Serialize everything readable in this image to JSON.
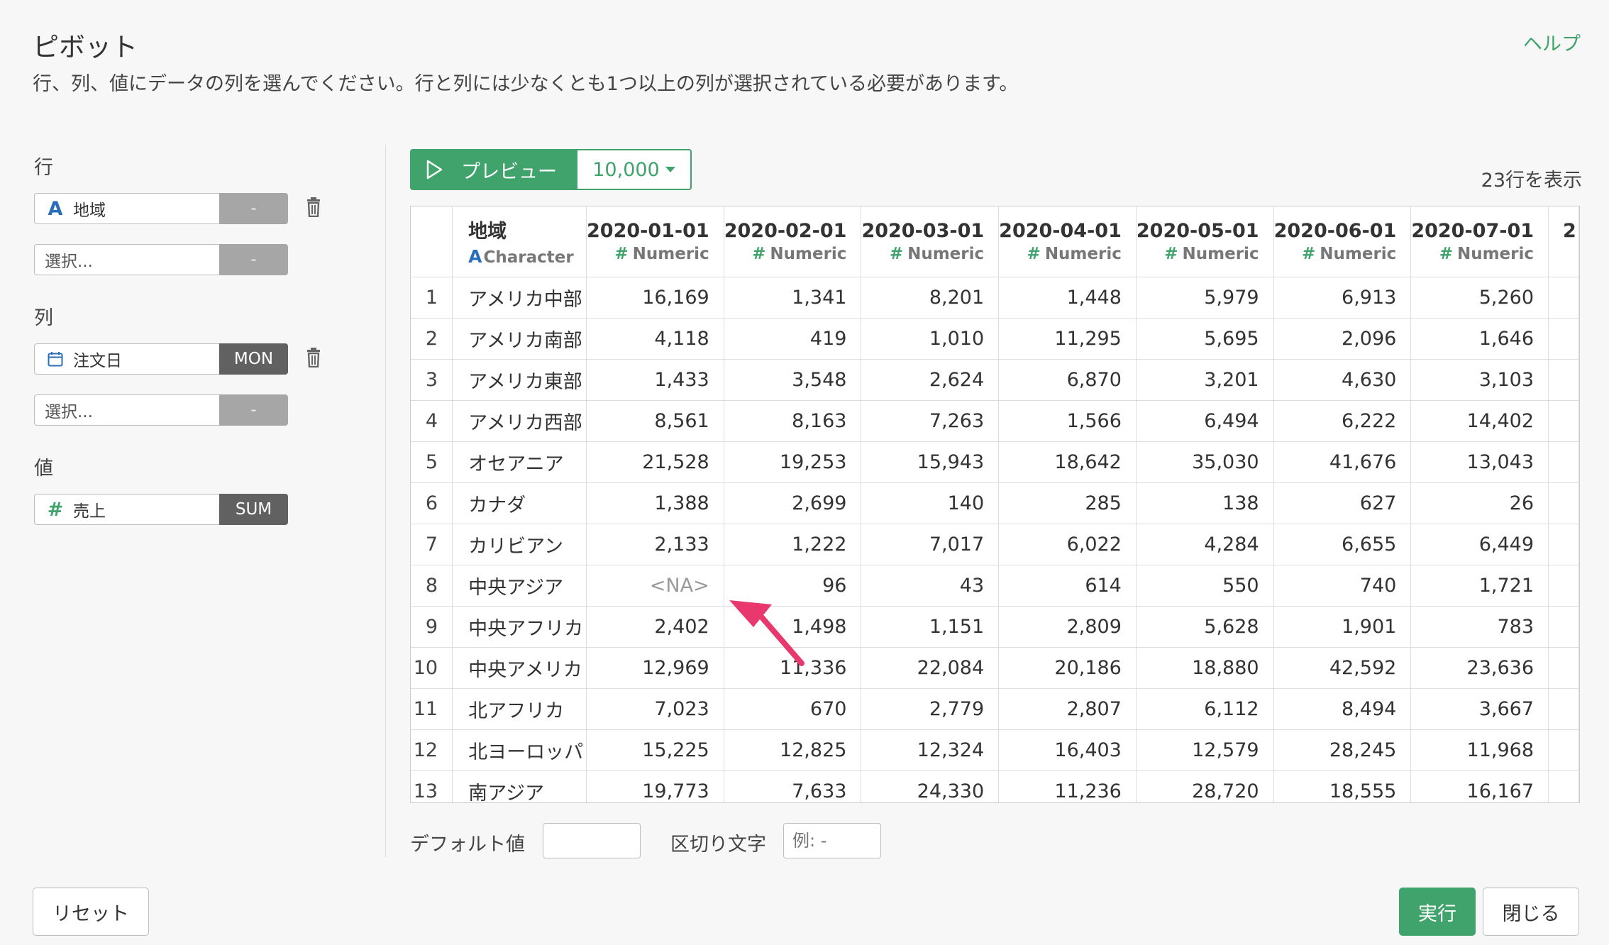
{
  "header": {
    "title": "ピボット",
    "description": "行、列、値にデータの列を選んでください。行と列には少なくとも1つ以上の列が選択されている必要があります。",
    "help_label": "ヘルプ"
  },
  "rows_section": {
    "label": "行",
    "field": {
      "type_icon": "A",
      "name": "地域",
      "option": "-"
    },
    "empty_select": {
      "placeholder": "選択...",
      "option": "-"
    }
  },
  "columns_section": {
    "label": "列",
    "field": {
      "type_icon": "calendar-icon",
      "name": "注文日",
      "option": "MON"
    },
    "empty_select": {
      "placeholder": "選択...",
      "option": "-"
    }
  },
  "values_section": {
    "label": "値",
    "field": {
      "type_icon": "#",
      "name": "売上",
      "option": "SUM"
    }
  },
  "preview": {
    "button_label": "プレビュー",
    "row_limit": "10,000",
    "row_count_text": "23行を表示"
  },
  "table": {
    "columns": [
      {
        "name": "地域",
        "type_icon": "A",
        "type": "Character"
      },
      {
        "name": "2020-01-01",
        "type_icon": "#",
        "type": "Numeric"
      },
      {
        "name": "2020-02-01",
        "type_icon": "#",
        "type": "Numeric"
      },
      {
        "name": "2020-03-01",
        "type_icon": "#",
        "type": "Numeric"
      },
      {
        "name": "2020-04-01",
        "type_icon": "#",
        "type": "Numeric"
      },
      {
        "name": "2020-05-01",
        "type_icon": "#",
        "type": "Numeric"
      },
      {
        "name": "2020-06-01",
        "type_icon": "#",
        "type": "Numeric"
      },
      {
        "name": "2020-07-01",
        "type_icon": "#",
        "type": "Numeric"
      },
      {
        "name": "2",
        "type_icon": "",
        "type": ""
      }
    ],
    "rows": [
      [
        "1",
        "アメリカ中部",
        "16,169",
        "1,341",
        "8,201",
        "1,448",
        "5,979",
        "6,913",
        "5,260"
      ],
      [
        "2",
        "アメリカ南部",
        "4,118",
        "419",
        "1,010",
        "11,295",
        "5,695",
        "2,096",
        "1,646"
      ],
      [
        "3",
        "アメリカ東部",
        "1,433",
        "3,548",
        "2,624",
        "6,870",
        "3,201",
        "4,630",
        "3,103"
      ],
      [
        "4",
        "アメリカ西部",
        "8,561",
        "8,163",
        "7,263",
        "1,566",
        "6,494",
        "6,222",
        "14,402"
      ],
      [
        "5",
        "オセアニア",
        "21,528",
        "19,253",
        "15,943",
        "18,642",
        "35,030",
        "41,676",
        "13,043"
      ],
      [
        "6",
        "カナダ",
        "1,388",
        "2,699",
        "140",
        "285",
        "138",
        "627",
        "26"
      ],
      [
        "7",
        "カリビアン",
        "2,133",
        "1,222",
        "7,017",
        "6,022",
        "4,284",
        "6,655",
        "6,449"
      ],
      [
        "8",
        "中央アジア",
        "<NA>",
        "96",
        "43",
        "614",
        "550",
        "740",
        "1,721"
      ],
      [
        "9",
        "中央アフリカ",
        "2,402",
        "1,498",
        "1,151",
        "2,809",
        "5,628",
        "1,901",
        "783"
      ],
      [
        "10",
        "中央アメリカ",
        "12,969",
        "11,336",
        "22,084",
        "20,186",
        "18,880",
        "42,592",
        "23,636"
      ],
      [
        "11",
        "北アフリカ",
        "7,023",
        "670",
        "2,779",
        "2,807",
        "6,112",
        "8,494",
        "3,667"
      ],
      [
        "12",
        "北ヨーロッパ",
        "15,225",
        "12,825",
        "12,324",
        "16,403",
        "12,579",
        "28,245",
        "11,968"
      ],
      [
        "13",
        "南アジア",
        "19,773",
        "7,633",
        "24,330",
        "11,236",
        "28,720",
        "18,555",
        "16,167"
      ]
    ]
  },
  "options": {
    "default_value_label": "デフォルト値",
    "default_value": "",
    "separator_label": "区切り文字",
    "separator_placeholder": "例: -"
  },
  "footer": {
    "reset_label": "リセット",
    "run_label": "実行",
    "close_label": "閉じる"
  },
  "colors": {
    "accent_green": "#3fa36b",
    "char_blue": "#2a6ebb",
    "annotation_pink": "#e8386d"
  }
}
